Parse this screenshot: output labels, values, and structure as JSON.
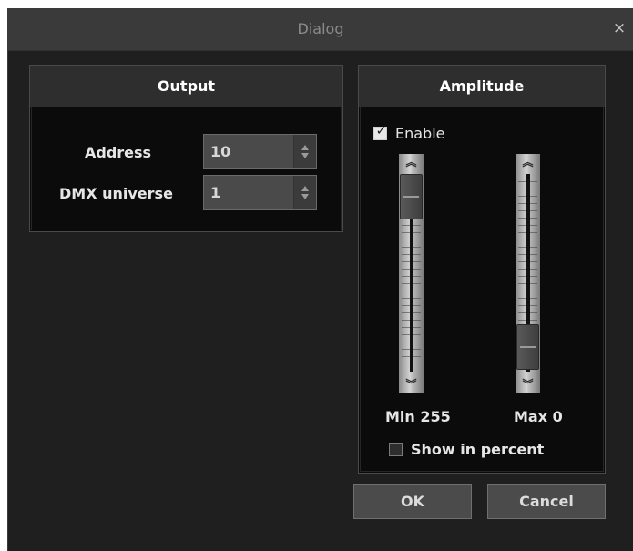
{
  "window": {
    "title": "Dialog",
    "close_glyph": "×"
  },
  "output": {
    "title": "Output",
    "address": {
      "label": "Address",
      "value": "10"
    },
    "universe": {
      "label": "DMX universe",
      "value": "1"
    }
  },
  "amplitude": {
    "title": "Amplitude",
    "enable": {
      "label": "Enable",
      "checked": true
    },
    "min_slider": {
      "label": "Min 255",
      "level": 1.0
    },
    "max_slider": {
      "label": "Max 0",
      "level": 0.0
    },
    "show_percent": {
      "label": "Show in percent",
      "checked": false
    }
  },
  "buttons": {
    "ok": "OK",
    "cancel": "Cancel"
  },
  "icons": {
    "up_chevron": "chevron-up-icon",
    "down_chevron": "chevron-down-icon"
  },
  "colors": {
    "background": "#1f1f1f",
    "group_bg": "#0b0b0b",
    "header_bg": "#2e2e2e",
    "text": "#e6e6e6"
  }
}
